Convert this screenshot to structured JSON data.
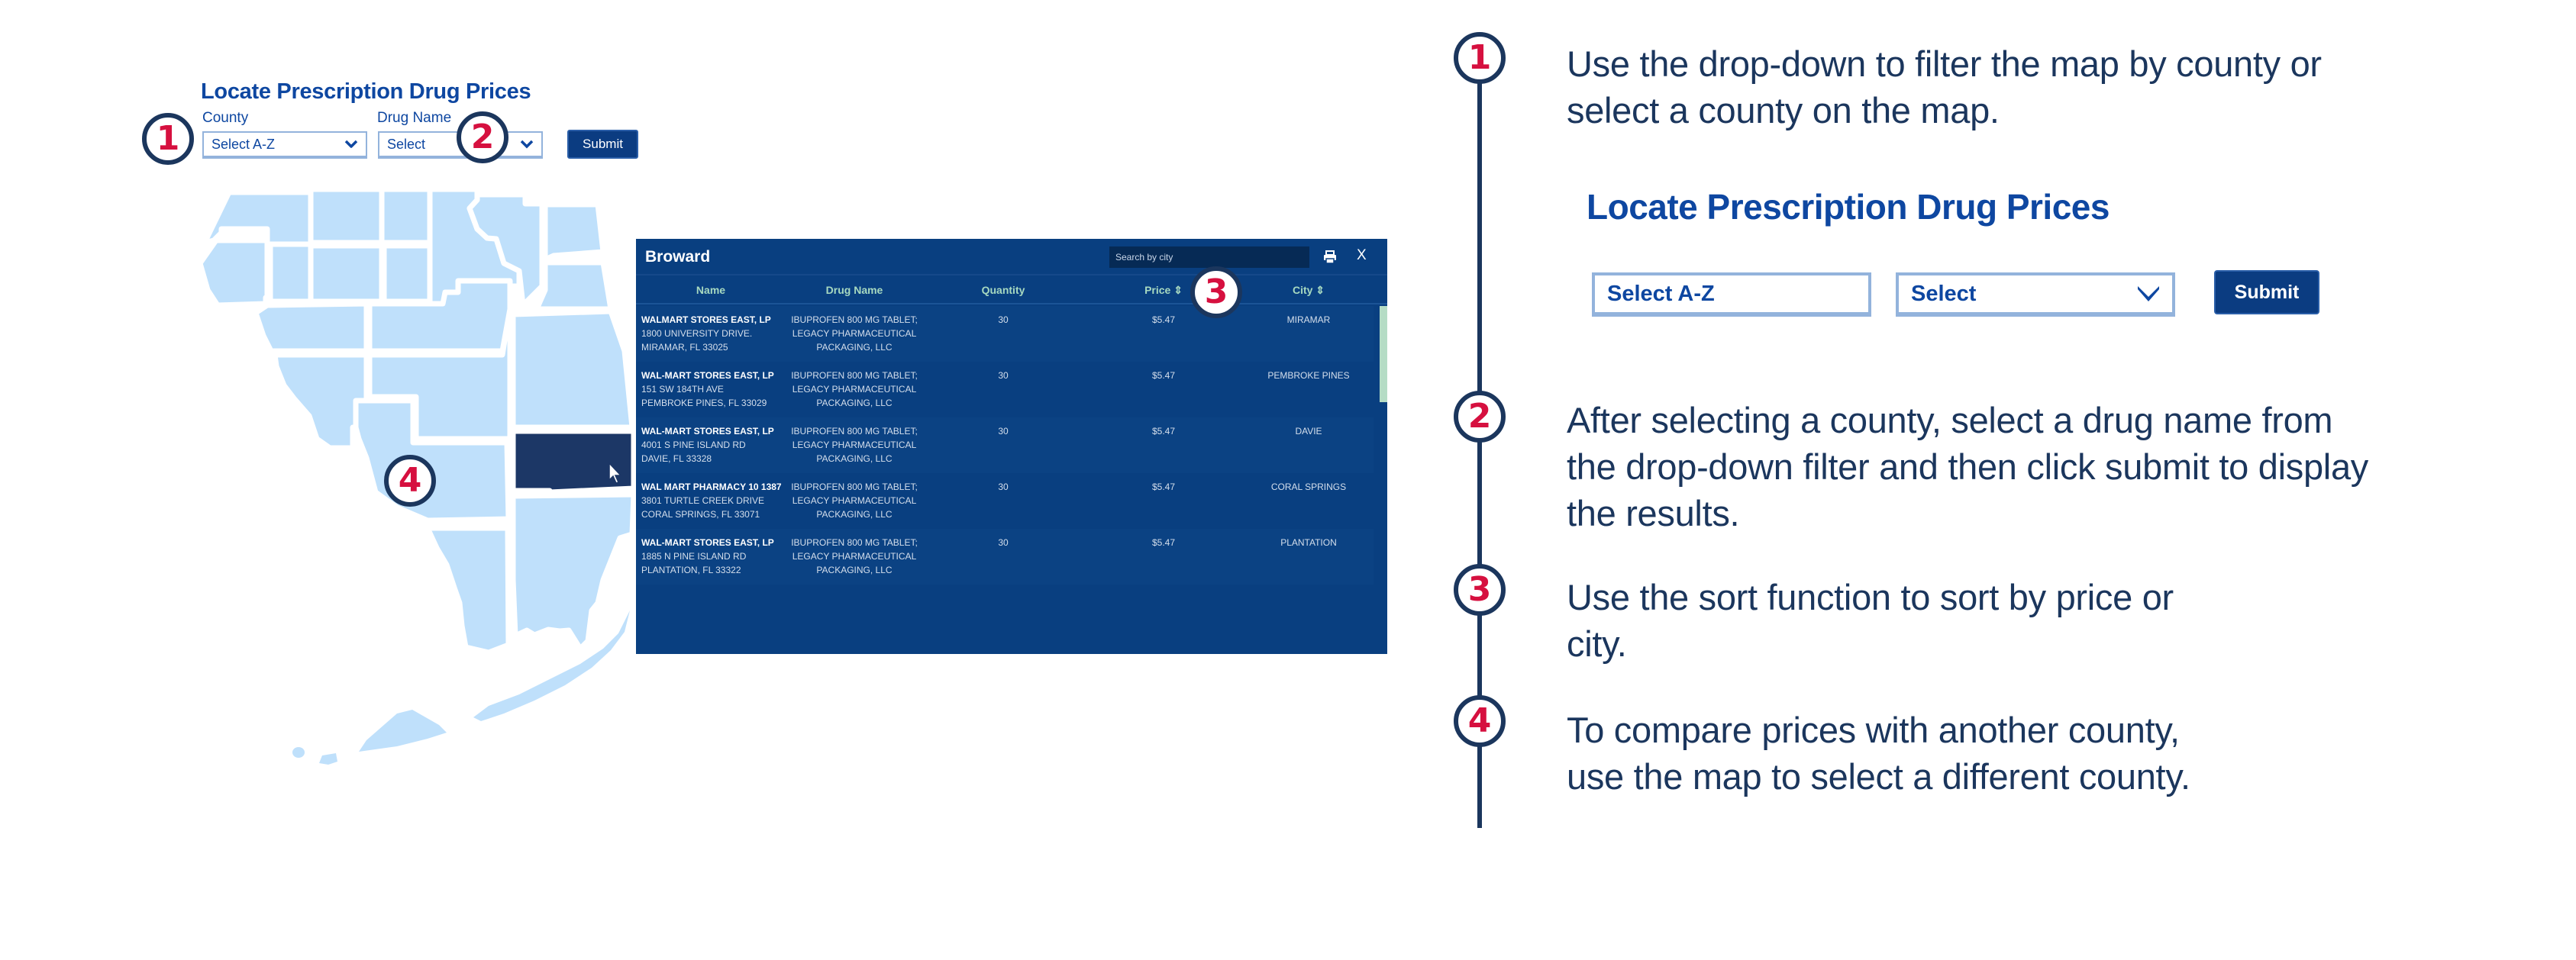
{
  "form": {
    "title": "Locate Prescription Drug Prices",
    "county_label": "County",
    "county_value": "Select A-Z",
    "drug_label": "Drug Name",
    "drug_value": "Select",
    "submit_label": "Submit"
  },
  "markers": [
    "1",
    "2",
    "3",
    "4"
  ],
  "map": {
    "selected_county": "Broward",
    "colors": {
      "county": "#bfe0fb",
      "selected": "#1c3766",
      "border": "#ffffff"
    }
  },
  "results_panel": {
    "title": "Broward",
    "search_placeholder": "Search by city",
    "print_icon": "printer-icon",
    "close_label": "X",
    "columns": [
      "Name",
      "Drug Name",
      "Quantity",
      "Price ⇕",
      "City ⇕"
    ],
    "rows": [
      {
        "name": "WALMART STORES EAST, LP",
        "address1": "1800 UNIVERSITY DRIVE.",
        "address2": "MIRAMAR, FL 33025",
        "drug": "IBUPROFEN 800 MG TABLET; LEGACY PHARMACEUTICAL PACKAGING, LLC",
        "quantity": "30",
        "price": "$5.47",
        "city": "MIRAMAR"
      },
      {
        "name": "WAL-MART STORES EAST, LP",
        "address1": "151 SW 184TH AVE",
        "address2": "PEMBROKE PINES, FL 33029",
        "drug": "IBUPROFEN 800 MG TABLET; LEGACY PHARMACEUTICAL PACKAGING, LLC",
        "quantity": "30",
        "price": "$5.47",
        "city": "PEMBROKE PINES"
      },
      {
        "name": "WAL-MART STORES EAST, LP",
        "address1": "4001 S PINE ISLAND RD",
        "address2": "DAVIE, FL 33328",
        "drug": "IBUPROFEN 800 MG TABLET; LEGACY PHARMACEUTICAL PACKAGING, LLC",
        "quantity": "30",
        "price": "$5.47",
        "city": "DAVIE"
      },
      {
        "name": "WAL MART PHARMACY 10 1387",
        "address1": "3801 TURTLE CREEK DRIVE",
        "address2": "CORAL SPRINGS, FL 33071",
        "drug": "IBUPROFEN 800 MG TABLET; LEGACY PHARMACEUTICAL PACKAGING, LLC",
        "quantity": "30",
        "price": "$5.47",
        "city": "CORAL SPRINGS"
      },
      {
        "name": "WAL-MART STORES EAST, LP",
        "address1": "1885 N PINE ISLAND RD",
        "address2": "PLANTATION, FL 33322",
        "drug": "IBUPROFEN 800 MG TABLET; LEGACY PHARMACEUTICAL PACKAGING, LLC",
        "quantity": "30",
        "price": "$5.47",
        "city": "PLANTATION"
      }
    ]
  },
  "instructions": {
    "steps": [
      {
        "number": "1",
        "text": "Use the drop-down to filter the map by county or select a county on the map."
      },
      {
        "number": "2",
        "text": "After selecting a county, select a drug name from the drop-down filter and then click submit to display the results."
      },
      {
        "number": "3",
        "text": "Use the sort function to sort by price or city."
      },
      {
        "number": "4",
        "text": "To compare prices with another county, use the map to select a different county."
      }
    ],
    "demo": {
      "title": "Locate Prescription Drug Prices",
      "county_value": "Select A-Z",
      "drug_value": "Select",
      "submit_label": "Submit"
    }
  },
  "colors": {
    "navy": "#1b365d",
    "brand_blue": "#0e47a1",
    "button_blue": "#0b3c81",
    "marker_red": "#d6103f",
    "panel_bg": "#093f80",
    "header_text": "#a7d9c0"
  }
}
